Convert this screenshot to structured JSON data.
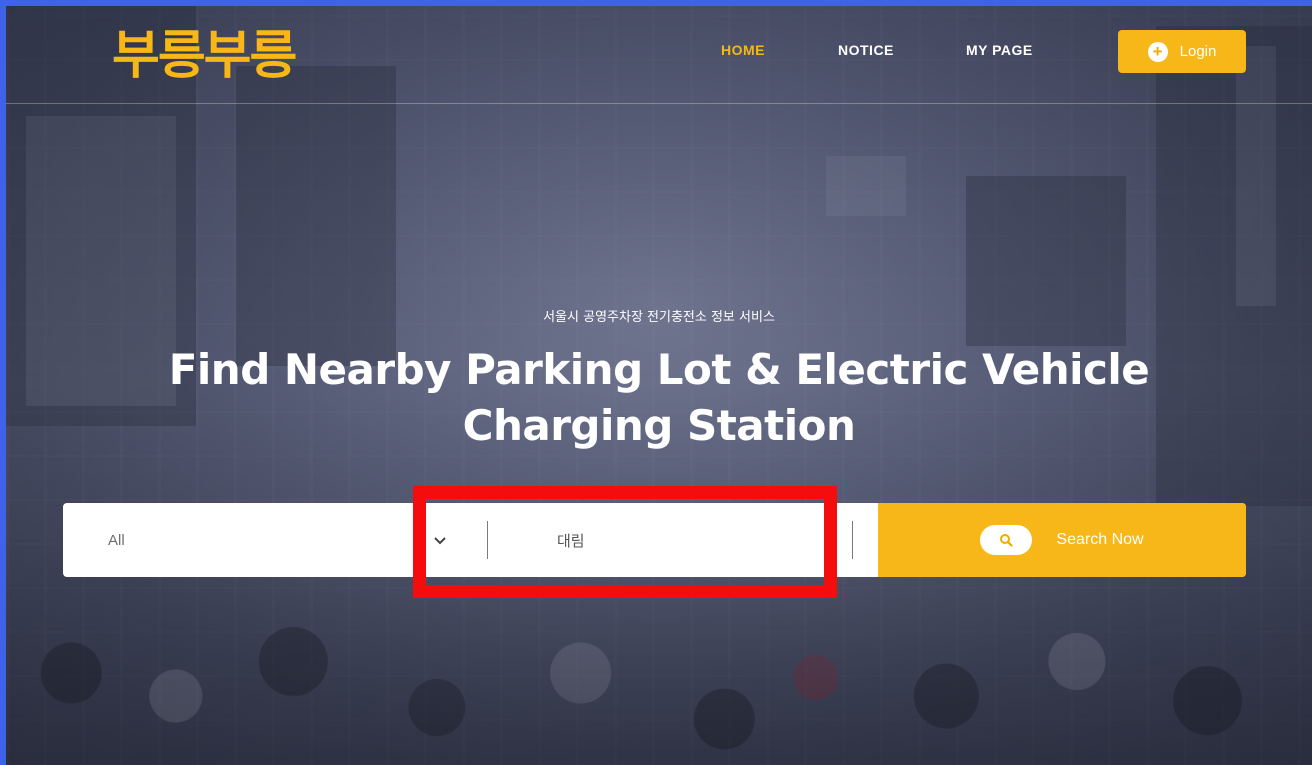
{
  "colors": {
    "accent": "#f7b718",
    "frame": "#3f63e8",
    "highlight": "#f50c0c",
    "text_light": "#ffffff"
  },
  "header": {
    "logo_text": "부릉부릉",
    "nav": [
      {
        "label": "HOME",
        "active": true
      },
      {
        "label": "NOTICE",
        "active": false
      },
      {
        "label": "MY PAGE",
        "active": false
      }
    ],
    "login": {
      "icon": "plus-circle-icon",
      "label": "Login"
    }
  },
  "hero": {
    "subtitle": "서울시 공영주차장 전기충전소 정보 서비스",
    "headline_line1": "Find Nearby Parking Lot & Electric Vehicle",
    "headline_line2": "Charging Station"
  },
  "search": {
    "category_selected": "All",
    "chevron_icon": "chevron-down-icon",
    "keyword_value": "대림",
    "button_icon": "search-icon",
    "button_label": "Search Now"
  }
}
